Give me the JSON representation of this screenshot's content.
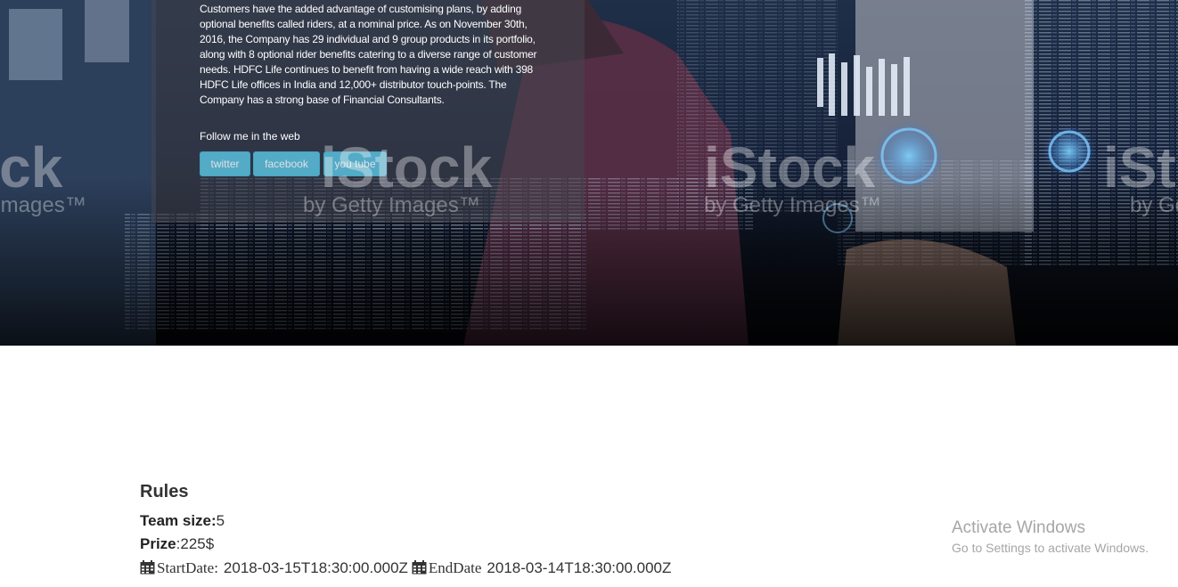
{
  "hero": {
    "about_text": "Customers have the added advantage of customising plans, by adding optional benefits called riders, at a nominal price. As on November 30th, 2016, the Company has 29 individual and 9 group products in its portfolio, along with 8 optional rider benefits catering to a diverse range of customer needs. HDFC Life continues to benefit from having a wide reach with 398 HDFC Life offices in India and 12,000+ distributor touch-points. The Company has a strong base of Financial Consultants.",
    "follow_label": "Follow me in the web",
    "social_buttons": [
      "twitter",
      "facebook",
      "you tube"
    ],
    "watermarks": [
      "iStock",
      "by Getty Images"
    ],
    "accent_color": "#5bc0de"
  },
  "rules": {
    "heading": "Rules",
    "team_size_label": "Team size:",
    "team_size_value": "5",
    "prize_label": "Prize",
    "prize_value": ":225$",
    "start_label": "StartDate:",
    "start_value": "2018-03-15T18:30:00.000Z",
    "end_label": "EndDate",
    "end_value": "2018-03-14T18:30:00.000Z",
    "date_icon": "calendar-icon"
  },
  "windows_notice": {
    "title": "Activate Windows",
    "subtitle": "Go to Settings to activate Windows."
  }
}
